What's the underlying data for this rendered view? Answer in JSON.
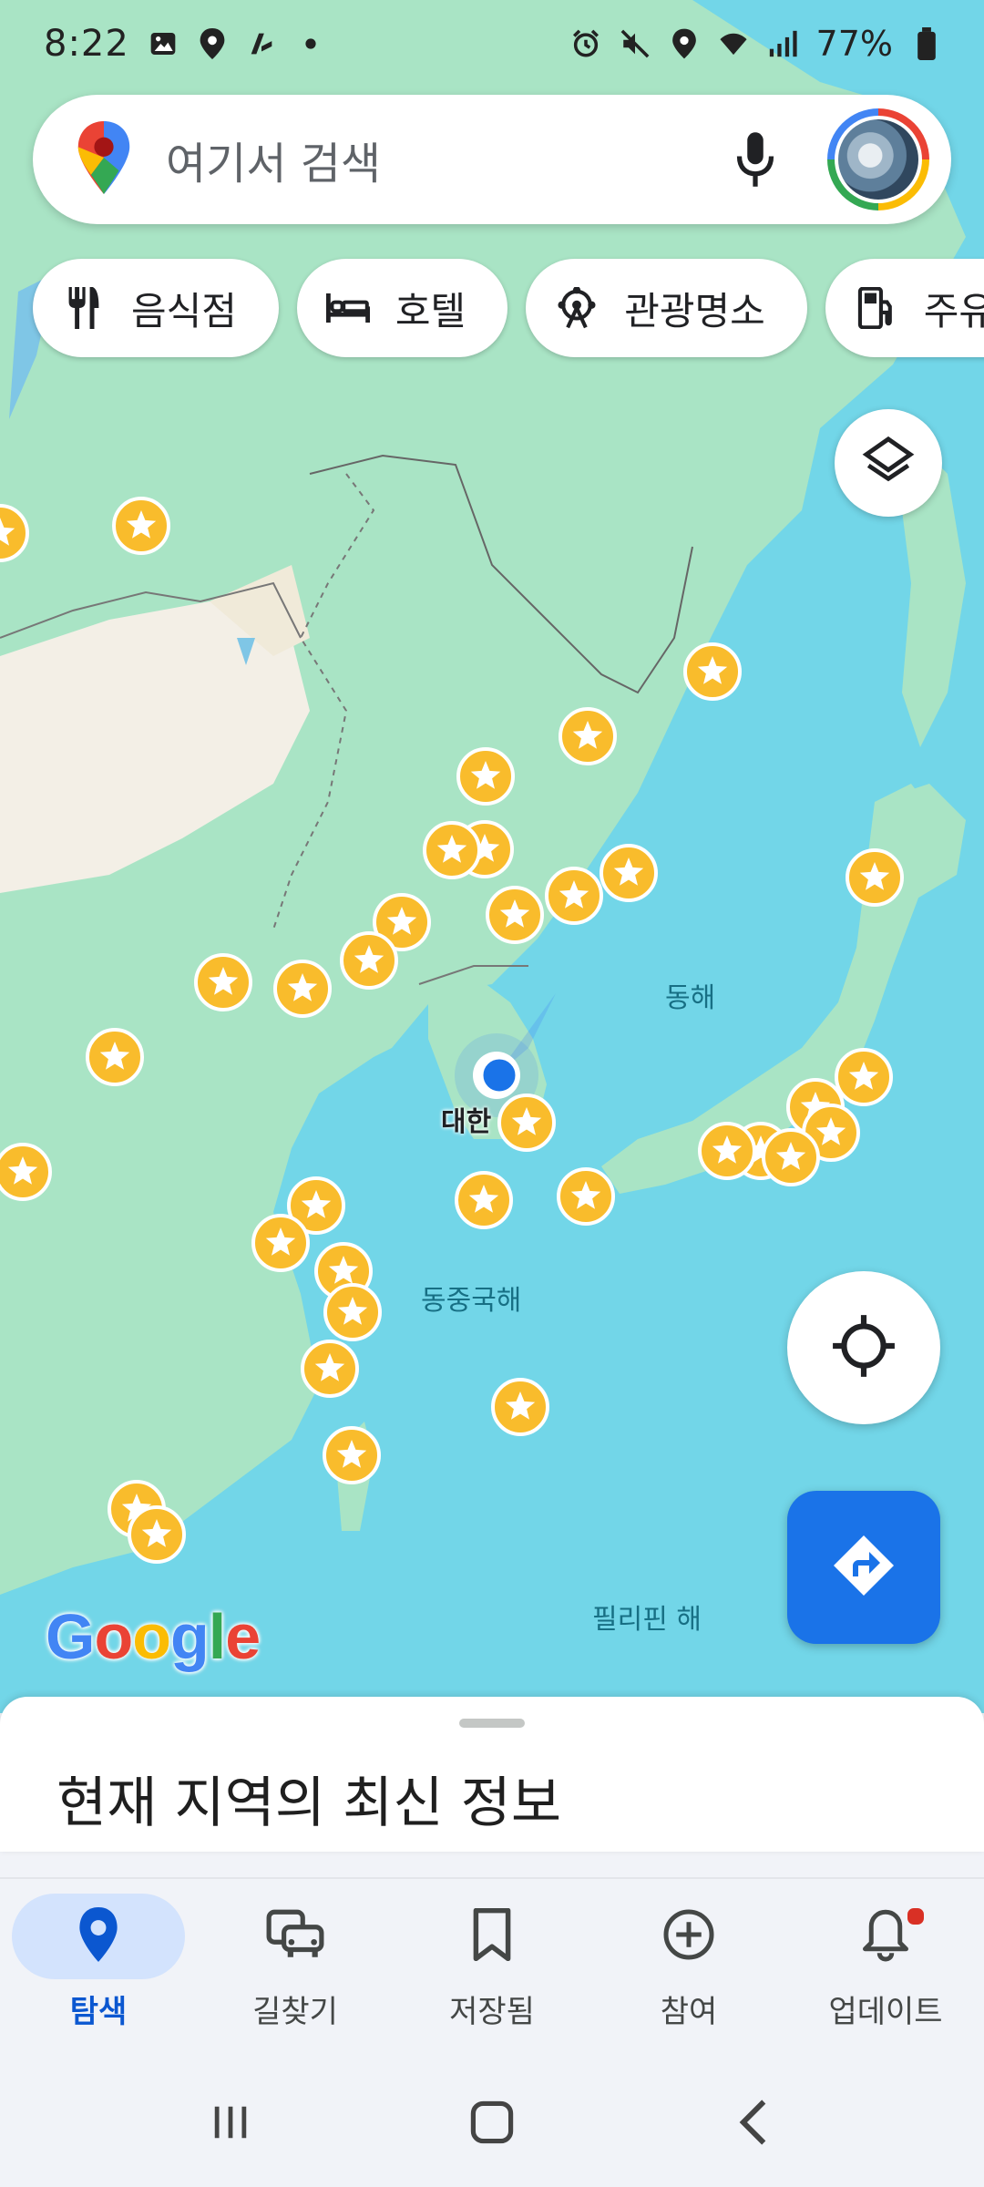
{
  "status_bar": {
    "time": "8:22",
    "battery": "77%"
  },
  "search": {
    "placeholder": "여기서 검색"
  },
  "chips": [
    {
      "label": "음식점",
      "icon": "fork-knife-icon"
    },
    {
      "label": "호텔",
      "icon": "bed-icon"
    },
    {
      "label": "관광명소",
      "icon": "ferris-wheel-icon"
    },
    {
      "label": "주유소",
      "icon": "gas-pump-icon"
    }
  ],
  "map": {
    "labels": {
      "east_sea": "동해",
      "korea": "대한",
      "east_china_sea": "동중국해",
      "philippine_sea": "필리핀 해"
    },
    "colors": {
      "water": "#72d6e8",
      "land": "#a9e4c5",
      "desert": "#f3efe6",
      "pin": "#f9bc2c",
      "location": "#1a73e8"
    }
  },
  "google_logo": {
    "letters": [
      "G",
      "o",
      "o",
      "g",
      "l",
      "e"
    ],
    "colors": [
      "#4285f4",
      "#ea4335",
      "#fbbc04",
      "#4285f4",
      "#34a853",
      "#ea4335"
    ]
  },
  "sheet": {
    "title": "현재 지역의 최신 정보"
  },
  "bottom_nav": [
    {
      "label": "탐색",
      "icon": "location-pin-icon",
      "active": true
    },
    {
      "label": "길찾기",
      "icon": "commute-icon",
      "active": false
    },
    {
      "label": "저장됨",
      "icon": "bookmark-icon",
      "active": false
    },
    {
      "label": "참여",
      "icon": "add-circle-icon",
      "active": false
    },
    {
      "label": "업데이트",
      "icon": "bell-icon",
      "active": false
    }
  ]
}
